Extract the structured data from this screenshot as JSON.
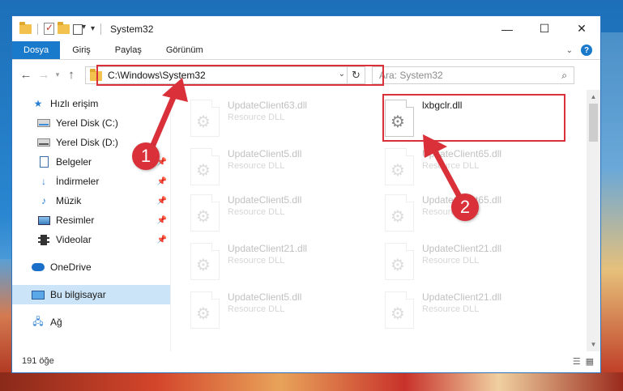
{
  "window": {
    "title": "System32"
  },
  "window_controls": {
    "minimize": "—",
    "maximize": "☐",
    "close": "✕"
  },
  "ribbon": {
    "tabs": [
      "Dosya",
      "Giriş",
      "Paylaş",
      "Görünüm"
    ]
  },
  "address": {
    "path": "C:\\Windows\\System32"
  },
  "search": {
    "placeholder": "Ara: System32"
  },
  "sidebar": {
    "items": [
      {
        "label": "Hızlı erişim",
        "icon": "star-icon"
      },
      {
        "label": "Yerel Disk (C:)",
        "icon": "disk-icon"
      },
      {
        "label": "Yerel Disk (D:)",
        "icon": "disk-icon"
      },
      {
        "label": "Belgeler",
        "icon": "documents-icon"
      },
      {
        "label": "İndirmeler",
        "icon": "downloads-icon"
      },
      {
        "label": "Müzik",
        "icon": "music-icon"
      },
      {
        "label": "Resimler",
        "icon": "pictures-icon"
      },
      {
        "label": "Videolar",
        "icon": "videos-icon"
      },
      {
        "label": "OneDrive",
        "icon": "cloud-icon"
      },
      {
        "label": "Bu bilgisayar",
        "icon": "computer-icon"
      },
      {
        "label": "Ağ",
        "icon": "network-icon"
      }
    ]
  },
  "files": [
    {
      "name": "UpdateClient63.dll",
      "type": "Resource DLL"
    },
    {
      "name": "lxbgclr.dll",
      "type": ""
    },
    {
      "name": "UpdateClient5.dll",
      "type": "Resource DLL"
    },
    {
      "name": "UpdateClient65.dll",
      "type": "Resource DLL"
    },
    {
      "name": "UpdateClient5.dll",
      "type": "Resource DLL"
    },
    {
      "name": "UpdateClient65.dll",
      "type": "Resource DLL"
    },
    {
      "name": "UpdateClient21.dll",
      "type": "Resource DLL"
    },
    {
      "name": "UpdateClient21.dll",
      "type": "Resource DLL"
    },
    {
      "name": "UpdateClient5.dll",
      "type": "Resource DLL"
    },
    {
      "name": "UpdateClient21.dll",
      "type": "Resource DLL"
    }
  ],
  "status": {
    "count": "191 öğe"
  },
  "callouts": {
    "one": "1",
    "two": "2"
  },
  "colors": {
    "accent": "#1979ca",
    "highlight": "#d9303a",
    "selection": "#cce4f7"
  }
}
